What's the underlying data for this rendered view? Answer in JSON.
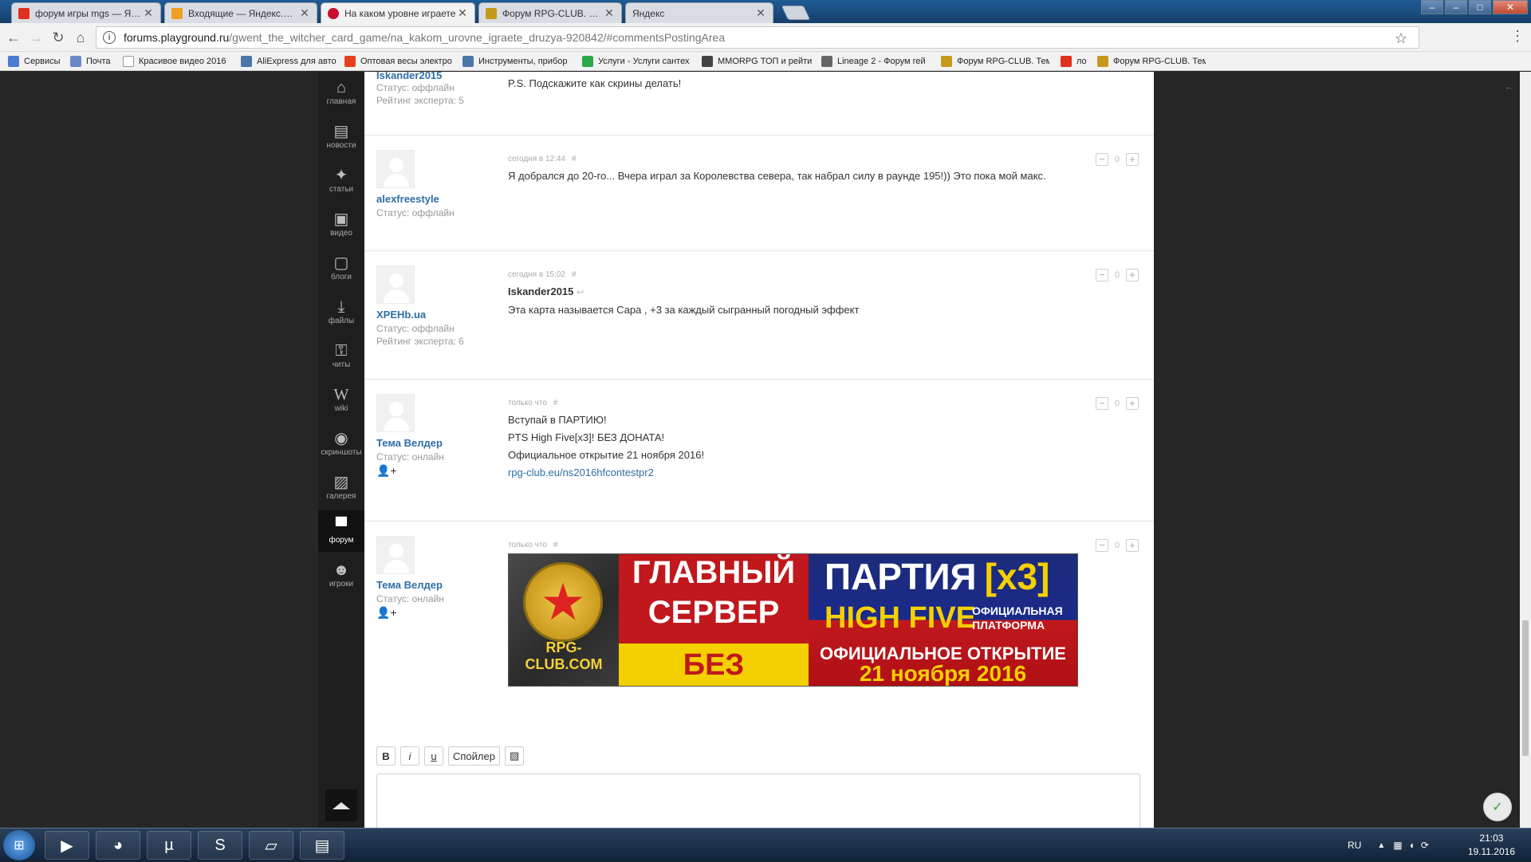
{
  "tabs": [
    {
      "title": "форум игры mgs — Яндекс",
      "color": "#e0301e"
    },
    {
      "title": "Входящие — Яндекс.Почта",
      "color": "#f0a020"
    },
    {
      "title": "На каком уровне играете",
      "color": "#c8102e"
    },
    {
      "title": "Форум RPG-CLUB. Тема: По",
      "color": "#c59a1b"
    },
    {
      "title": "Яндекс",
      "color": "#cccccc"
    }
  ],
  "window_buttons": {
    "minimize": "–",
    "maximize": "□",
    "close": "✕"
  },
  "nav": {
    "back": "←",
    "forward": "→",
    "reload": "↻",
    "home": "⌂",
    "star": "☆",
    "menu": "⋮"
  },
  "url": {
    "host": "forums.playground.ru",
    "path": "/gwent_the_witcher_card_game/na_kakom_urovne_igraete_druzya-920842/#commentsPostingArea"
  },
  "bookmarks": [
    {
      "label": "Сервисы",
      "color": "#4a7bd0"
    },
    {
      "label": "Почта",
      "color": "#6a88c8"
    },
    {
      "label": "Красивое видео 2016",
      "color": "#aaaaaa"
    },
    {
      "label": "AliExpress для авто",
      "color": "#4a76a8"
    },
    {
      "label": "Оптовая весы электро",
      "color": "#e8401c"
    },
    {
      "label": "Инструменты, прибор",
      "color": "#4a76a8"
    },
    {
      "label": "Услуги - Услуги сантех",
      "color": "#2aa84a"
    },
    {
      "label": "MMORPG ТОП и рейти",
      "color": "#444444"
    },
    {
      "label": "Lineage 2 - Форум гей",
      "color": "#666666"
    },
    {
      "label": "Форум RPG-CLUB. Тем",
      "color": "#c59a1b"
    },
    {
      "label": "ло",
      "color": "#e0301e"
    },
    {
      "label": "Форум RPG-CLUB. Тем",
      "color": "#c59a1b"
    }
  ],
  "sidenav": [
    {
      "label": "главная",
      "icon": "⌂"
    },
    {
      "label": "новости",
      "icon": "▤"
    },
    {
      "label": "статьи",
      "icon": "✦"
    },
    {
      "label": "видео",
      "icon": "▣"
    },
    {
      "label": "блоги",
      "icon": "▢"
    },
    {
      "label": "файлы",
      "icon": "⤓"
    },
    {
      "label": "читы",
      "icon": "⚿"
    },
    {
      "label": "wiki",
      "icon": "W"
    },
    {
      "label": "скриншоты",
      "icon": "◉"
    },
    {
      "label": "галерея",
      "icon": "▨"
    },
    {
      "label": "форум",
      "icon": "▀",
      "active": true
    },
    {
      "label": "игроки",
      "icon": "☻"
    }
  ],
  "comments": [
    {
      "username": "Iskander2015",
      "status": "Статус: оффлайн",
      "rating": "Рейтинг эксперта: 5",
      "lines": [
        "P.S. Подскажите как скрины делать!"
      ]
    },
    {
      "username": "alexfreestyle",
      "status": "Статус: оффлайн",
      "time": "сегодня в 12:44",
      "hash": "#",
      "lines": [
        "Я добрался до 20-го... Вчера играл за Королевства севера, так набрал силу в раунде 195!)) Это пока мой макс."
      ],
      "votes": 0
    },
    {
      "username": "XPEHb.ua",
      "status": "Статус: оффлайн",
      "rating": "Рейтинг эксперта: 6",
      "time": "сегодня в 15:02",
      "hash": "#",
      "quote_author": "Iskander2015",
      "reply_icon": "↩",
      "lines": [
        "Эта карта называется Сара , +3 за каждый сыгранный погодный эффект"
      ],
      "votes": 0
    },
    {
      "username": "Тема Велдер",
      "status": "Статус: онлайн",
      "time": "только что",
      "hash": "#",
      "lines": [
        "Вступай в ПАРТИЮ!",
        "PTS High Five[x3]! БЕЗ ДОНАТА!",
        "Официальное открытие 21 ноября 2016!"
      ],
      "link": "rpg-club.eu/ns2016hfcontestpr2",
      "votes": 0
    },
    {
      "username": "Тема Велдер",
      "status": "Статус: онлайн",
      "time": "только что",
      "hash": "#",
      "votes": 0
    }
  ],
  "vote": {
    "minus": "−",
    "plus": "+"
  },
  "add_friend_icon": "👤+",
  "banner": {
    "site": "RPG-CLUB.COM",
    "line1": "ГЛАВНЫЙ",
    "line2": "СЕРВЕР",
    "line3": "БЕЗ ДОНАТА",
    "title": "ПАРТИЯ",
    "title_x": "[x3]",
    "chronicle": "HIGH FIVE",
    "platform": "ОФИЦИАЛЬНАЯ ПЛАТФОРМА",
    "opening": "ОФИЦИАЛЬНОЕ ОТКРЫТИЕ",
    "date": "21 ноября 2016"
  },
  "editor": {
    "bold": "B",
    "italic": "i",
    "underline": "u",
    "spoiler": "Спойлер",
    "image_icon": "▨"
  },
  "taskbar": {
    "apps": [
      {
        "name": "media-player-icon",
        "glyph": "▶"
      },
      {
        "name": "chrome-icon",
        "glyph": "◕"
      },
      {
        "name": "utorrent-icon",
        "glyph": "µ"
      },
      {
        "name": "skype-icon",
        "glyph": "S"
      },
      {
        "name": "window-app-icon",
        "glyph": "▱"
      },
      {
        "name": "explorer-icon",
        "glyph": "▤"
      }
    ],
    "lang": "RU",
    "time": "21:03",
    "date": "19.11.2016"
  }
}
